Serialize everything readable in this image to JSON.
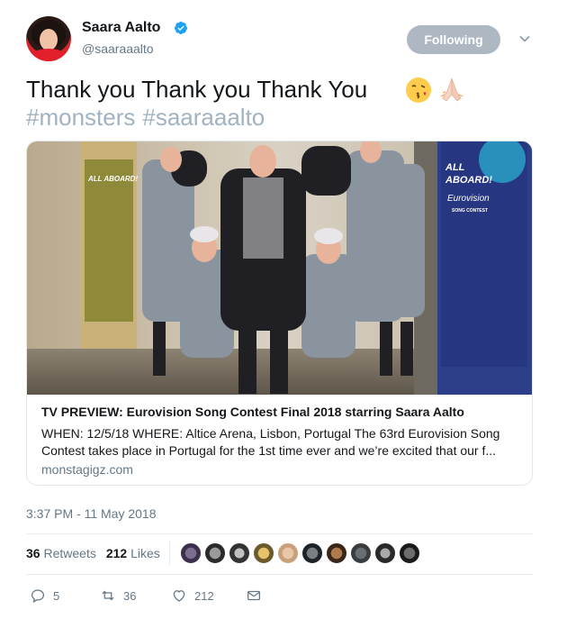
{
  "user": {
    "name": "Saara Aalto",
    "handle": "@saaraaalto",
    "follow_label": "Following"
  },
  "tweet": {
    "text": "Thank you Thank you Thank You",
    "hashtags": [
      "#monsters",
      "#saaraaalto"
    ],
    "emojis": [
      "face-blowing-kiss-icon",
      "folded-hands-icon"
    ]
  },
  "card": {
    "title": "TV PREVIEW: Eurovision Song Contest Final 2018 starring Saara Aalto",
    "description": "WHEN: 12/5/18 WHERE: Altice Arena, Lisbon, Portugal The 63rd Eurovision Song Contest takes place in Portugal for the 1st time ever and we’re excited that our f...",
    "domain": "monstagigz.com",
    "banner_left": "ALL ABOARD!",
    "banner_right_line1": "ALL",
    "banner_right_line2": "ABOARD!",
    "banner_right_logo": "Eurovision",
    "banner_right_sub": "SONG CONTEST"
  },
  "timestamp": "3:37 PM - 11 May 2018",
  "stats": {
    "retweets_count": "36",
    "retweets_label": "Retweets",
    "likes_count": "212",
    "likes_label": "Likes"
  },
  "actions": {
    "replies": "5",
    "retweets": "36",
    "likes": "212"
  },
  "colors": {
    "verified": "#1da1f2",
    "follow_button": "#adb8c2",
    "hashtag": "#a1b3c2",
    "secondary_text": "#657786"
  }
}
